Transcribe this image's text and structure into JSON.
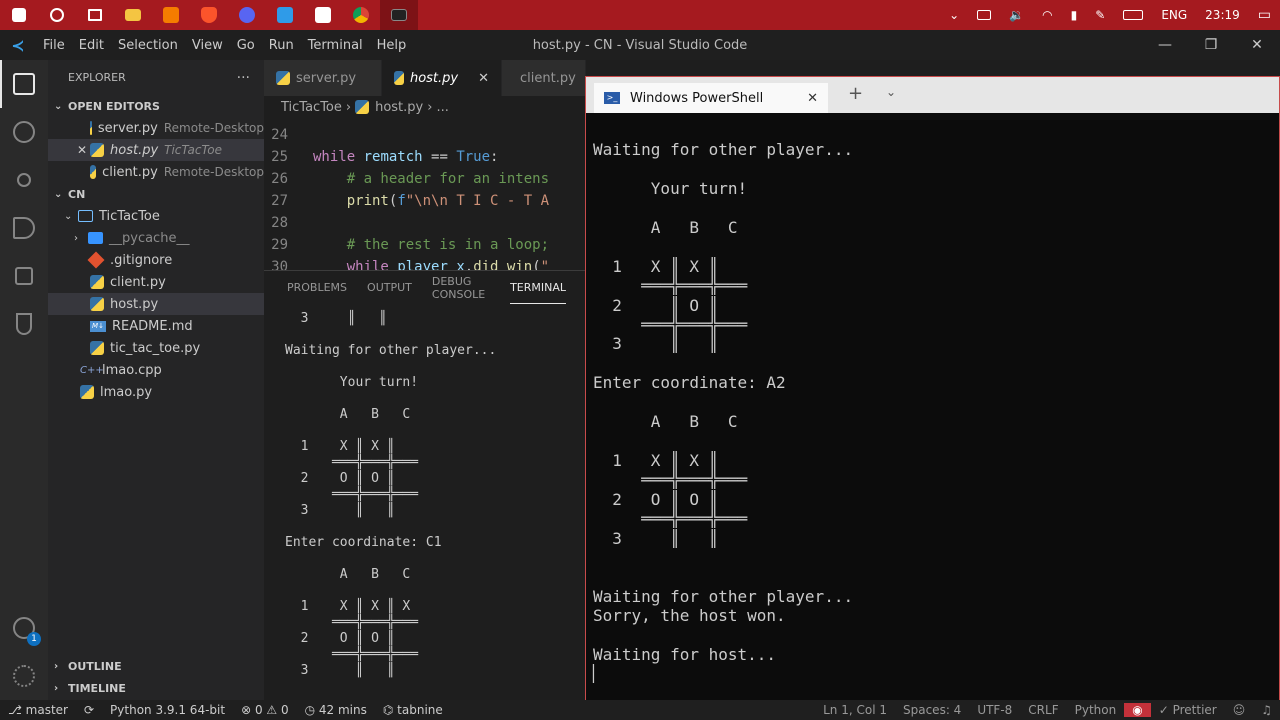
{
  "taskbar": {
    "apps": [
      "windows-start",
      "search",
      "task-view",
      "file-explorer",
      "sublime-text",
      "brave",
      "discord",
      "vs-code",
      "notion",
      "chrome",
      "powershell"
    ],
    "language": "ENG",
    "clock": "23:19"
  },
  "titlebar": {
    "menus": [
      "File",
      "Edit",
      "Selection",
      "View",
      "Go",
      "Run",
      "Terminal",
      "Help"
    ],
    "title": "host.py - CN - Visual Studio Code"
  },
  "activitybar": {
    "accounts_badge": "1"
  },
  "sidebar": {
    "header": "EXPLORER",
    "more": "···",
    "open_editors_label": "OPEN EDITORS",
    "open_editors": [
      {
        "name": "server.py",
        "desc": "Remote-Desktop"
      },
      {
        "name": "host.py",
        "desc": "TicTacToe"
      },
      {
        "name": "client.py",
        "desc": "Remote-Desktop"
      }
    ],
    "cn_label": "CN",
    "tree": {
      "tictactoe": "TicTacToe",
      "pycache": "__pycache__",
      "gitignore": ".gitignore",
      "client": "client.py",
      "host": "host.py",
      "readme": "README.md",
      "tictactoe_py": "tic_tac_toe.py",
      "lmao_cpp": "lmao.cpp",
      "lmao_py": "lmao.py"
    },
    "outline": "OUTLINE",
    "timeline": "TIMELINE"
  },
  "tabs": [
    {
      "label": "server.py"
    },
    {
      "label": "host.py"
    },
    {
      "label": "client.py"
    }
  ],
  "breadcrumb": {
    "folder": "TicTacToe",
    "file": "host.py",
    "more": "..."
  },
  "editor": {
    "lines": [
      {
        "n": "24",
        "code": ""
      },
      {
        "n": "25",
        "code": "while rematch == True:"
      },
      {
        "n": "26",
        "code": "    # a header for an intens"
      },
      {
        "n": "27",
        "code": "    print(f\"\\n\\n T I C - T A"
      },
      {
        "n": "28",
        "code": ""
      },
      {
        "n": "29",
        "code": "    # the rest is in a loop;"
      },
      {
        "n": "30",
        "code": "    while player_x.did_win(\""
      }
    ]
  },
  "panel": {
    "tabs": [
      "PROBLEMS",
      "OUTPUT",
      "DEBUG CONSOLE",
      "TERMINAL"
    ],
    "terminal_text": "  3     ║   ║\n\nWaiting for other player...\n\n       Your turn!\n\n       A   B   C\n\n  1    X ║ X ║\n      ═══╬═══╬═══\n  2    O ║ O ║\n      ═══╬═══╬═══\n  3      ║   ║\n\nEnter coordinate: C1\n\n       A   B   C\n\n  1    X ║ X ║ X\n      ═══╬═══╬═══\n  2    O ║ O ║\n      ═══╬═══╬═══\n  3      ║   ║"
  },
  "powershell": {
    "tab_title": "Windows PowerShell",
    "terminal_text": "\nWaiting for other player...\n\n      Your turn!\n\n      A   B   C\n\n  1   X ║ X ║\n     ═══╬═══╬═══\n  2     ║ O ║\n     ═══╬═══╬═══\n  3     ║   ║\n\nEnter coordinate: A2\n\n      A   B   C\n\n  1   X ║ X ║\n     ═══╬═══╬═══\n  2   O ║ O ║\n     ═══╬═══╬═══\n  3     ║   ║\n\n\nWaiting for other player...\nSorry, the host won.\n\nWaiting for host...\n▏"
  },
  "statusbar": {
    "branch": "master",
    "python": "Python 3.9.1 64-bit",
    "errors": "0",
    "warnings": "0",
    "time": "42 mins",
    "tabnine": "tabnine",
    "position": "Ln 1, Col 1",
    "spaces": "Spaces: 4",
    "encoding": "UTF-8",
    "eol": "CRLF",
    "language": "Python",
    "prettier": "Prettier"
  },
  "colors": {
    "taskbar": "#a51a1f",
    "accent": "#0e70c0",
    "python_keyword": "#c586c0"
  }
}
